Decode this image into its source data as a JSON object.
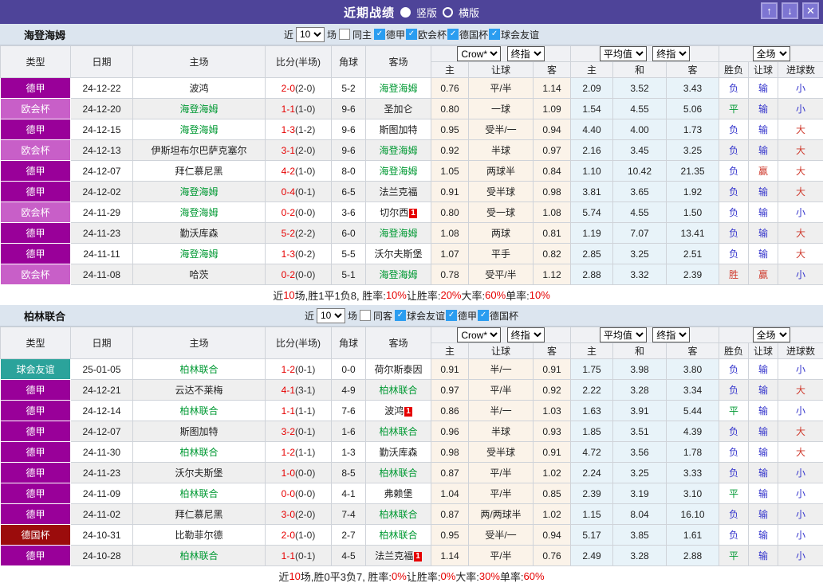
{
  "titlebar": {
    "title": "近期战绩",
    "radio_selected": "竖版",
    "radio_unselected": "横版",
    "buttons": {
      "up": "↑",
      "down": "↓",
      "close": "✕"
    }
  },
  "filter_labels": {
    "near": "近",
    "games": "场"
  },
  "table_header": {
    "col_type": "类型",
    "col_date": "日期",
    "col_home": "主场",
    "col_score": "比分(半场)",
    "col_corner": "角球",
    "col_away": "客场",
    "odds_select": "Crow*",
    "odds_final_select": "终指",
    "avg_select": "平均值",
    "avg_final_select": "终指",
    "scope_select": "全场",
    "sub_home": "主",
    "sub_handicap": "让球",
    "sub_away": "客",
    "sub_avg_home": "主",
    "sub_avg_draw": "和",
    "sub_avg_away": "客",
    "sub_result": "胜负",
    "sub_let": "让球",
    "sub_goals": "进球数"
  },
  "league_colors": {
    "德甲": "#990099",
    "欧会杯": "#c85fc8",
    "德国杯": "#9b0c0c",
    "球会友谊": "#2ba39b"
  },
  "value_colors": {
    "胜": "#cf3b2e",
    "平": "#009933",
    "负": "#3333cc",
    "赢": "#cf3b2e",
    "输": "#3333cc",
    "大": "#cf3b2e",
    "小": "#3333cc"
  },
  "tables": [
    {
      "team": "海登海姆",
      "filter": {
        "count": "10",
        "same_label": "同主",
        "leagues": [
          "德甲",
          "欧会杯",
          "德国杯",
          "球会友谊"
        ]
      },
      "rows": [
        {
          "league": "德甲",
          "date": "24-12-22",
          "home": "波鸿",
          "home_self": false,
          "home_rc": false,
          "ft": "2-0",
          "ht": "(2-0)",
          "corner": "5-2",
          "away": "海登海姆",
          "away_self": true,
          "away_rc": false,
          "odds_home": "0.76",
          "handicap": "平/半",
          "odds_away": "1.14",
          "avg_home": "2.09",
          "avg_draw": "3.52",
          "avg_away": "3.43",
          "result": "负",
          "let_result": "输",
          "goal_result": "小"
        },
        {
          "league": "欧会杯",
          "date": "24-12-20",
          "home": "海登海姆",
          "home_self": true,
          "home_rc": false,
          "ft": "1-1",
          "ht": "(1-0)",
          "corner": "9-6",
          "away": "圣加仑",
          "away_self": false,
          "away_rc": false,
          "odds_home": "0.80",
          "handicap": "一球",
          "odds_away": "1.09",
          "avg_home": "1.54",
          "avg_draw": "4.55",
          "avg_away": "5.06",
          "result": "平",
          "let_result": "输",
          "goal_result": "小"
        },
        {
          "league": "德甲",
          "date": "24-12-15",
          "home": "海登海姆",
          "home_self": true,
          "home_rc": false,
          "ft": "1-3",
          "ht": "(1-2)",
          "corner": "9-6",
          "away": "斯图加特",
          "away_self": false,
          "away_rc": false,
          "odds_home": "0.95",
          "handicap": "受半/一",
          "odds_away": "0.94",
          "avg_home": "4.40",
          "avg_draw": "4.00",
          "avg_away": "1.73",
          "result": "负",
          "let_result": "输",
          "goal_result": "大"
        },
        {
          "league": "欧会杯",
          "date": "24-12-13",
          "home": "伊斯坦布尔巴萨克塞尔",
          "home_self": false,
          "home_rc": false,
          "ft": "3-1",
          "ht": "(2-0)",
          "corner": "9-6",
          "away": "海登海姆",
          "away_self": true,
          "away_rc": false,
          "odds_home": "0.92",
          "handicap": "半球",
          "odds_away": "0.97",
          "avg_home": "2.16",
          "avg_draw": "3.45",
          "avg_away": "3.25",
          "result": "负",
          "let_result": "输",
          "goal_result": "大"
        },
        {
          "league": "德甲",
          "date": "24-12-07",
          "home": "拜仁慕尼黑",
          "home_self": false,
          "home_rc": false,
          "ft": "4-2",
          "ht": "(1-0)",
          "corner": "8-0",
          "away": "海登海姆",
          "away_self": true,
          "away_rc": false,
          "odds_home": "1.05",
          "handicap": "两球半",
          "odds_away": "0.84",
          "avg_home": "1.10",
          "avg_draw": "10.42",
          "avg_away": "21.35",
          "result": "负",
          "let_result": "赢",
          "goal_result": "大"
        },
        {
          "league": "德甲",
          "date": "24-12-02",
          "home": "海登海姆",
          "home_self": true,
          "home_rc": false,
          "ft": "0-4",
          "ht": "(0-1)",
          "corner": "6-5",
          "away": "法兰克福",
          "away_self": false,
          "away_rc": false,
          "odds_home": "0.91",
          "handicap": "受半球",
          "odds_away": "0.98",
          "avg_home": "3.81",
          "avg_draw": "3.65",
          "avg_away": "1.92",
          "result": "负",
          "let_result": "输",
          "goal_result": "大"
        },
        {
          "league": "欧会杯",
          "date": "24-11-29",
          "home": "海登海姆",
          "home_self": true,
          "home_rc": false,
          "ft": "0-2",
          "ht": "(0-0)",
          "corner": "3-6",
          "away": "切尔西",
          "away_self": false,
          "away_rc": true,
          "odds_home": "0.80",
          "handicap": "受一球",
          "odds_away": "1.08",
          "avg_home": "5.74",
          "avg_draw": "4.55",
          "avg_away": "1.50",
          "result": "负",
          "let_result": "输",
          "goal_result": "小"
        },
        {
          "league": "德甲",
          "date": "24-11-23",
          "home": "勤沃库森",
          "home_self": false,
          "home_rc": false,
          "ft": "5-2",
          "ht": "(2-2)",
          "corner": "6-0",
          "away": "海登海姆",
          "away_self": true,
          "away_rc": false,
          "odds_home": "1.08",
          "handicap": "两球",
          "odds_away": "0.81",
          "avg_home": "1.19",
          "avg_draw": "7.07",
          "avg_away": "13.41",
          "result": "负",
          "let_result": "输",
          "goal_result": "大"
        },
        {
          "league": "德甲",
          "date": "24-11-11",
          "home": "海登海姆",
          "home_self": true,
          "home_rc": false,
          "ft": "1-3",
          "ht": "(0-2)",
          "corner": "5-5",
          "away": "沃尔夫斯堡",
          "away_self": false,
          "away_rc": false,
          "odds_home": "1.07",
          "handicap": "平手",
          "odds_away": "0.82",
          "avg_home": "2.85",
          "avg_draw": "3.25",
          "avg_away": "2.51",
          "result": "负",
          "let_result": "输",
          "goal_result": "大"
        },
        {
          "league": "欧会杯",
          "date": "24-11-08",
          "home": "哈茨",
          "home_self": false,
          "home_rc": false,
          "ft": "0-2",
          "ht": "(0-0)",
          "corner": "5-1",
          "away": "海登海姆",
          "away_self": true,
          "away_rc": false,
          "odds_home": "0.78",
          "handicap": "受平/半",
          "odds_away": "1.12",
          "avg_home": "2.88",
          "avg_draw": "3.32",
          "avg_away": "2.39",
          "result": "胜",
          "let_result": "赢",
          "goal_result": "小"
        }
      ],
      "summary": [
        {
          "text": "近",
          "red": false
        },
        {
          "text": "10",
          "red": true
        },
        {
          "text": "场,胜1平1负8, 胜率:",
          "red": false
        },
        {
          "text": "10%",
          "red": true
        },
        {
          "text": " 让胜率:",
          "red": false
        },
        {
          "text": "20%",
          "red": true
        },
        {
          "text": " 大率:",
          "red": false
        },
        {
          "text": "60%",
          "red": true
        },
        {
          "text": " 单率:",
          "red": false
        },
        {
          "text": "10%",
          "red": true
        }
      ]
    },
    {
      "team": "柏林联合",
      "filter": {
        "count": "10",
        "same_label": "同客",
        "leagues": [
          "球会友谊",
          "德甲",
          "德国杯"
        ]
      },
      "rows": [
        {
          "league": "球会友谊",
          "date": "25-01-05",
          "home": "柏林联合",
          "home_self": true,
          "home_rc": false,
          "ft": "1-2",
          "ht": "(0-1)",
          "corner": "0-0",
          "away": "荷尔斯泰因",
          "away_self": false,
          "away_rc": false,
          "odds_home": "0.91",
          "handicap": "半/一",
          "odds_away": "0.91",
          "avg_home": "1.75",
          "avg_draw": "3.98",
          "avg_away": "3.80",
          "result": "负",
          "let_result": "输",
          "goal_result": "小"
        },
        {
          "league": "德甲",
          "date": "24-12-21",
          "home": "云达不莱梅",
          "home_self": false,
          "home_rc": false,
          "ft": "4-1",
          "ht": "(3-1)",
          "corner": "4-9",
          "away": "柏林联合",
          "away_self": true,
          "away_rc": false,
          "odds_home": "0.97",
          "handicap": "平/半",
          "odds_away": "0.92",
          "avg_home": "2.22",
          "avg_draw": "3.28",
          "avg_away": "3.34",
          "result": "负",
          "let_result": "输",
          "goal_result": "大"
        },
        {
          "league": "德甲",
          "date": "24-12-14",
          "home": "柏林联合",
          "home_self": true,
          "home_rc": false,
          "ft": "1-1",
          "ht": "(1-1)",
          "corner": "7-6",
          "away": "波鸿",
          "away_self": false,
          "away_rc": true,
          "odds_home": "0.86",
          "handicap": "半/一",
          "odds_away": "1.03",
          "avg_home": "1.63",
          "avg_draw": "3.91",
          "avg_away": "5.44",
          "result": "平",
          "let_result": "输",
          "goal_result": "小"
        },
        {
          "league": "德甲",
          "date": "24-12-07",
          "home": "斯图加特",
          "home_self": false,
          "home_rc": false,
          "ft": "3-2",
          "ht": "(0-1)",
          "corner": "1-6",
          "away": "柏林联合",
          "away_self": true,
          "away_rc": false,
          "odds_home": "0.96",
          "handicap": "半球",
          "odds_away": "0.93",
          "avg_home": "1.85",
          "avg_draw": "3.51",
          "avg_away": "4.39",
          "result": "负",
          "let_result": "输",
          "goal_result": "大"
        },
        {
          "league": "德甲",
          "date": "24-11-30",
          "home": "柏林联合",
          "home_self": true,
          "home_rc": false,
          "ft": "1-2",
          "ht": "(1-1)",
          "corner": "1-3",
          "away": "勤沃库森",
          "away_self": false,
          "away_rc": false,
          "odds_home": "0.98",
          "handicap": "受半球",
          "odds_away": "0.91",
          "avg_home": "4.72",
          "avg_draw": "3.56",
          "avg_away": "1.78",
          "result": "负",
          "let_result": "输",
          "goal_result": "大"
        },
        {
          "league": "德甲",
          "date": "24-11-23",
          "home": "沃尔夫斯堡",
          "home_self": false,
          "home_rc": false,
          "ft": "1-0",
          "ht": "(0-0)",
          "corner": "8-5",
          "away": "柏林联合",
          "away_self": true,
          "away_rc": false,
          "odds_home": "0.87",
          "handicap": "平/半",
          "odds_away": "1.02",
          "avg_home": "2.24",
          "avg_draw": "3.25",
          "avg_away": "3.33",
          "result": "负",
          "let_result": "输",
          "goal_result": "小"
        },
        {
          "league": "德甲",
          "date": "24-11-09",
          "home": "柏林联合",
          "home_self": true,
          "home_rc": false,
          "ft": "0-0",
          "ht": "(0-0)",
          "corner": "4-1",
          "away": "弗赖堡",
          "away_self": false,
          "away_rc": false,
          "odds_home": "1.04",
          "handicap": "平/半",
          "odds_away": "0.85",
          "avg_home": "2.39",
          "avg_draw": "3.19",
          "avg_away": "3.10",
          "result": "平",
          "let_result": "输",
          "goal_result": "小"
        },
        {
          "league": "德甲",
          "date": "24-11-02",
          "home": "拜仁慕尼黑",
          "home_self": false,
          "home_rc": false,
          "ft": "3-0",
          "ht": "(2-0)",
          "corner": "7-4",
          "away": "柏林联合",
          "away_self": true,
          "away_rc": false,
          "odds_home": "0.87",
          "handicap": "两/两球半",
          "odds_away": "1.02",
          "avg_home": "1.15",
          "avg_draw": "8.04",
          "avg_away": "16.10",
          "result": "负",
          "let_result": "输",
          "goal_result": "小"
        },
        {
          "league": "德国杯",
          "date": "24-10-31",
          "home": "比勒菲尔德",
          "home_self": false,
          "home_rc": false,
          "ft": "2-0",
          "ht": "(1-0)",
          "corner": "2-7",
          "away": "柏林联合",
          "away_self": true,
          "away_rc": false,
          "odds_home": "0.95",
          "handicap": "受半/一",
          "odds_away": "0.94",
          "avg_home": "5.17",
          "avg_draw": "3.85",
          "avg_away": "1.61",
          "result": "负",
          "let_result": "输",
          "goal_result": "小"
        },
        {
          "league": "德甲",
          "date": "24-10-28",
          "home": "柏林联合",
          "home_self": true,
          "home_rc": false,
          "ft": "1-1",
          "ht": "(0-1)",
          "corner": "4-5",
          "away": "法兰克福",
          "away_self": false,
          "away_rc": true,
          "odds_home": "1.14",
          "handicap": "平/半",
          "odds_away": "0.76",
          "avg_home": "2.49",
          "avg_draw": "3.28",
          "avg_away": "2.88",
          "result": "平",
          "let_result": "输",
          "goal_result": "小"
        }
      ],
      "summary": [
        {
          "text": "近",
          "red": false
        },
        {
          "text": "10",
          "red": true
        },
        {
          "text": "场,胜0平3负7, 胜率:",
          "red": false
        },
        {
          "text": "0%",
          "red": true
        },
        {
          "text": " 让胜率:",
          "red": false
        },
        {
          "text": "0%",
          "red": true
        },
        {
          "text": " 大率:",
          "red": false
        },
        {
          "text": "30%",
          "red": true
        },
        {
          "text": " 单率:",
          "red": false
        },
        {
          "text": "60%",
          "red": true
        }
      ]
    }
  ]
}
